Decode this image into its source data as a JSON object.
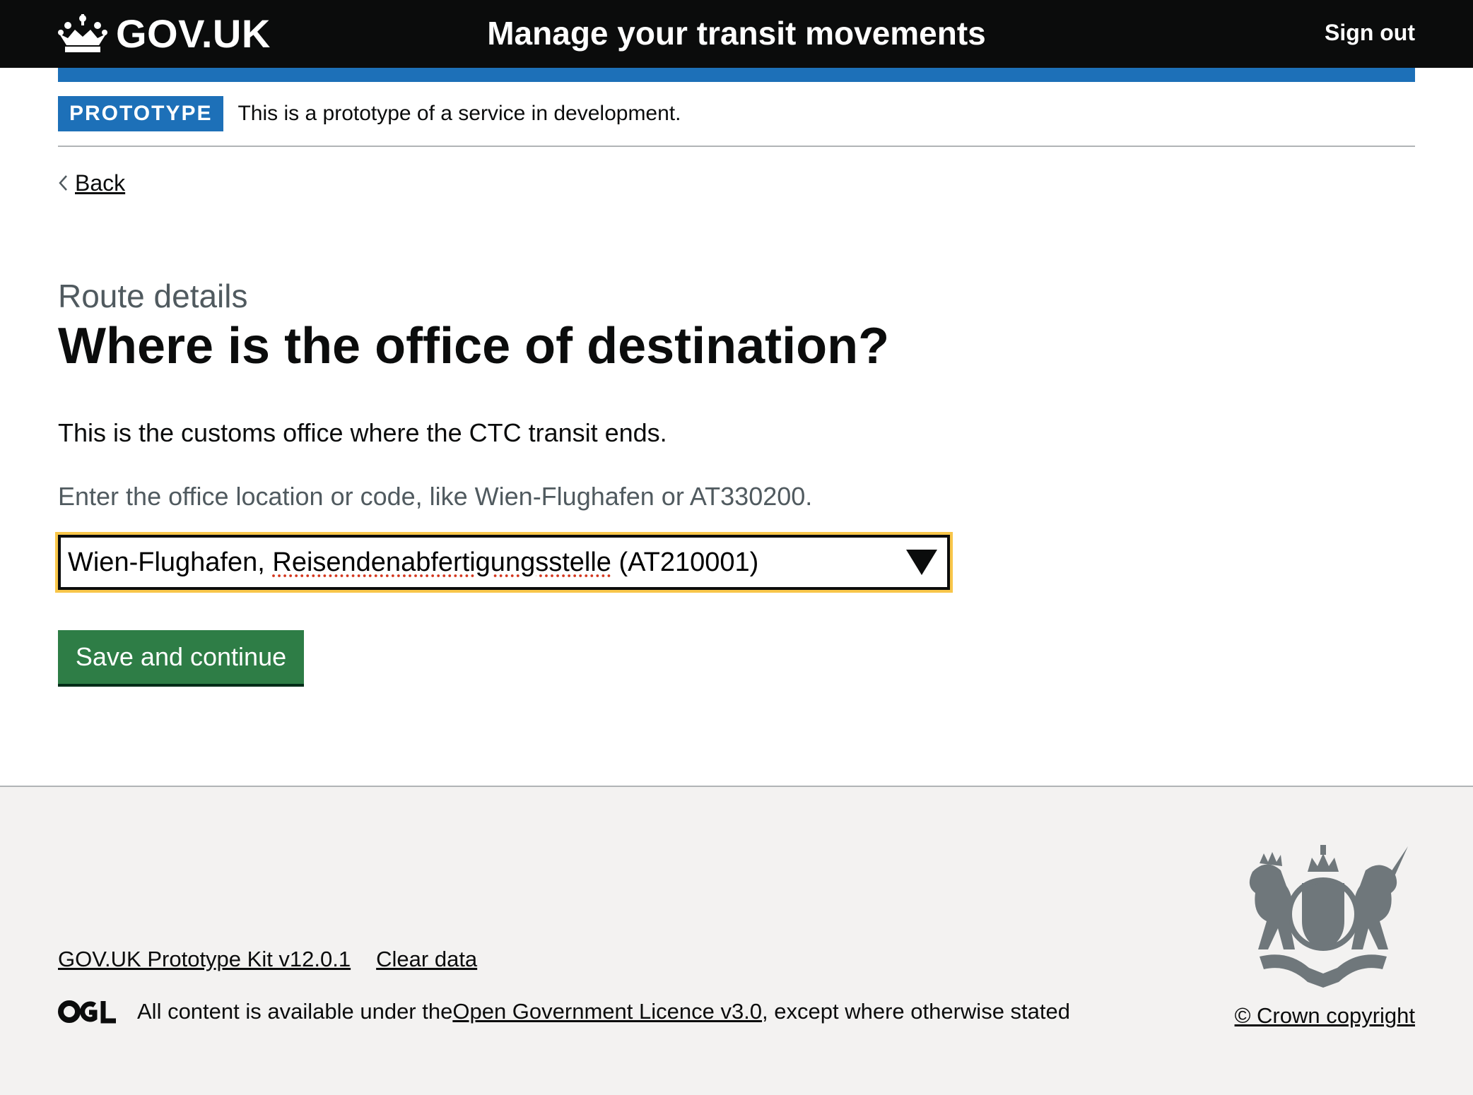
{
  "header": {
    "logo_text": "GOV.UK",
    "service_name": "Manage your transit movements",
    "sign_out": "Sign out"
  },
  "phase_banner": {
    "tag": "PROTOTYPE",
    "text": "This is a prototype of a service in development."
  },
  "back_link": "Back",
  "main": {
    "caption": "Route details",
    "heading": "Where is the office of destination?",
    "body": "This is the customs office where the CTC transit ends.",
    "hint": "Enter the office location or code, like Wien-Flughafen or AT330200.",
    "select": {
      "value_prefix": "Wien-Flughafen, ",
      "value_spell": "Reisendenabfertigungsstelle",
      "value_suffix": " (AT210001)"
    },
    "button": "Save and continue"
  },
  "footer": {
    "links": [
      "GOV.UK Prototype Kit v12.0.1",
      "Clear data"
    ],
    "licence_prefix": "All content is available under the ",
    "licence_link": "Open Government Licence v3.0",
    "licence_suffix": ", except where otherwise stated",
    "copyright": "© Crown copyright"
  },
  "colors": {
    "header_bg": "#0b0c0c",
    "brand_blue": "#1d70b8",
    "button_green": "#2e7d46",
    "focus_yellow": "#f8c64a",
    "footer_bg": "#f3f2f1"
  }
}
